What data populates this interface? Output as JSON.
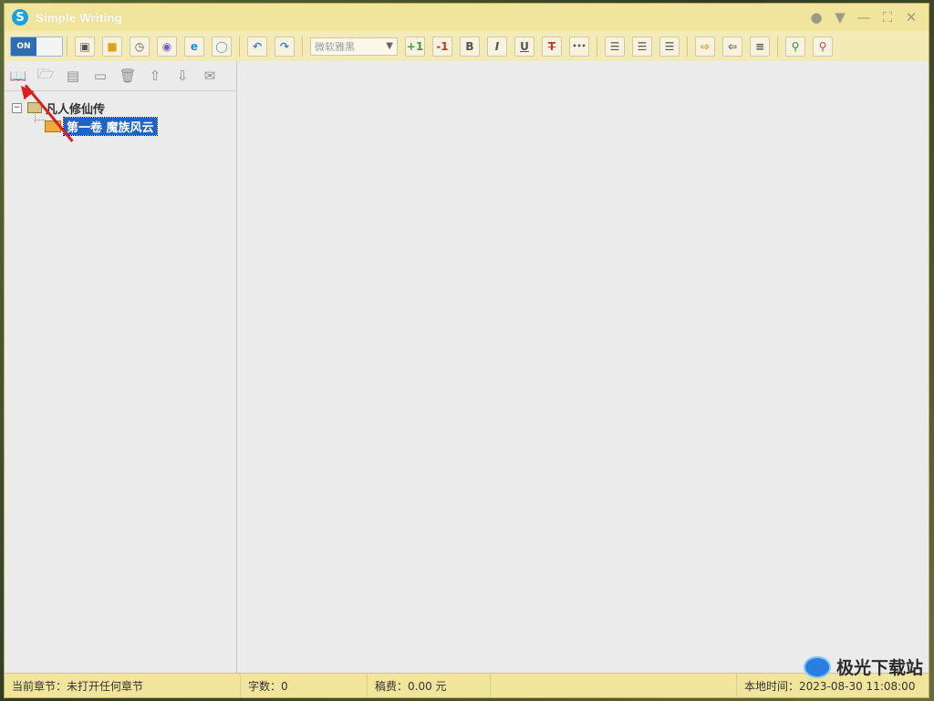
{
  "window": {
    "title": "Simple Writing",
    "logo_letter": "S"
  },
  "toolbar": {
    "toggle_label": "ON",
    "font_name": "微软雅黑",
    "size_up_label": "+1",
    "size_down_label": "-1",
    "bold_label": "B",
    "italic_label": "I",
    "underline_label": "U",
    "strike_label": "T",
    "more_label": "•••"
  },
  "sidebar": {
    "book_title": "凡人修仙传",
    "volume_title": "第一卷  魔族风云",
    "book_expander": "−"
  },
  "status": {
    "current_chapter": "当前章节：未打开任何章节",
    "word_count": "字数：0",
    "fee": "稿费：0.00 元",
    "local_time": "本地时间：2023-08-30 11:08:00"
  },
  "watermark": {
    "text": "极光下载站"
  },
  "colors": {
    "titlebar": "#f1e59d",
    "toolbar": "#f4eab6",
    "selection": "#1f63c7",
    "annotation_arrow": "#d8201f"
  }
}
